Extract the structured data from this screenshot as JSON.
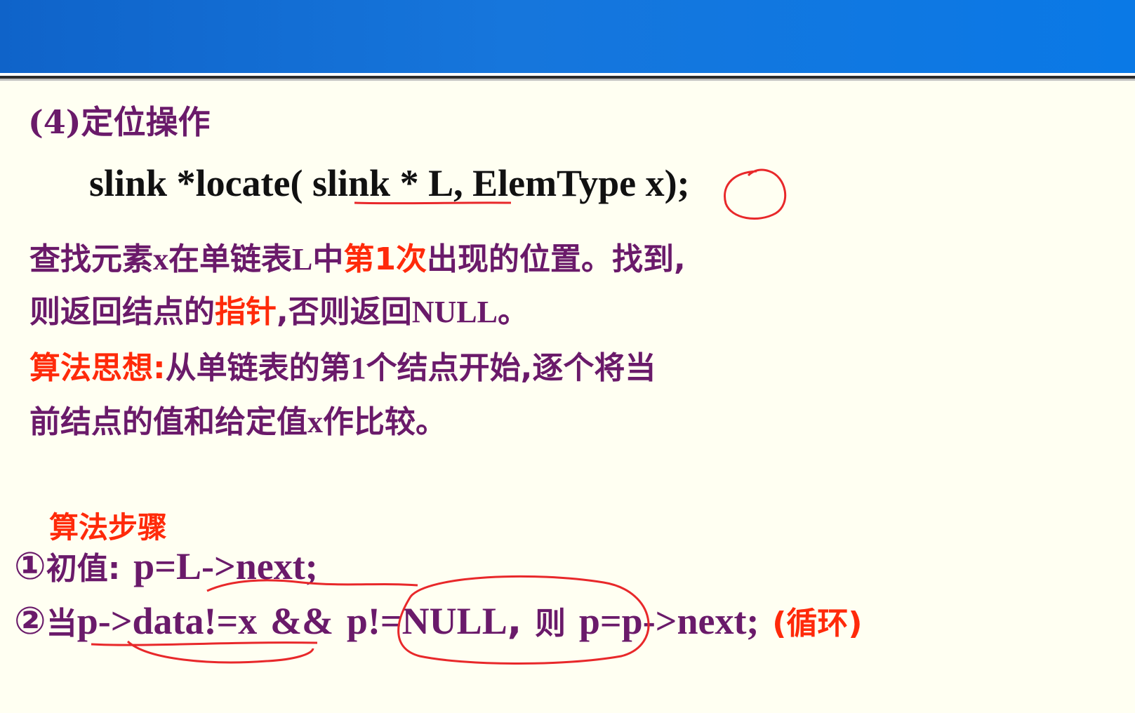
{
  "heading": {
    "num": "(4)",
    "text": "定位操作"
  },
  "signature": "slink *locate( slink * L, ElemType x);",
  "paragraph1": {
    "a": "查找元素",
    "b": "x",
    "c": "在单链表",
    "d": "L",
    "e": "中",
    "f": "第1次",
    "g": "出现的位置。找到,"
  },
  "paragraph2": {
    "a": "则返回结点的",
    "b": "指针",
    "c": ",否则返回",
    "d": "NULL",
    "e": "。"
  },
  "paragraph3": {
    "label": "算法思想:",
    "a": "从单链表的第",
    "b": "1",
    "c": "个结点开始,逐个将当"
  },
  "paragraph4": {
    "a": "前结点的值和给定值",
    "b": "x",
    "c": "作比较。"
  },
  "steps_title": "算法步骤",
  "step1": {
    "marker": "①",
    "label": "初值:",
    "code": "p=L->next;"
  },
  "step2": {
    "marker": "②",
    "label": "当",
    "cond1": "p->data!=x",
    "amp": "&&",
    "cond2": "p!=NULL",
    "comma": ",",
    "then": "则",
    "code": "p=p->next;",
    "note": "(循环)"
  },
  "colors": {
    "header_blue": "#1676dc",
    "purple_text": "#6a1a6a",
    "red_text": "#ff2a0a",
    "annotation_red": "#e8282a"
  }
}
